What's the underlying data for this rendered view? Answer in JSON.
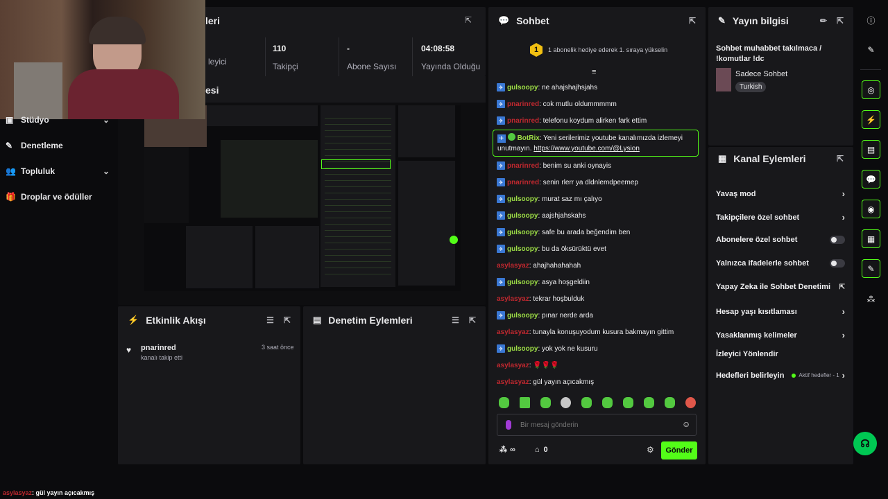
{
  "top_panel": {
    "title_fragment": "leri"
  },
  "stats": [
    {
      "value": "",
      "label": "leyici"
    },
    {
      "value": "110",
      "label": "Takipçi"
    },
    {
      "value": "-",
      "label": "Abone Sayısı"
    },
    {
      "value": "04:08:58",
      "label": "Yayında Olduğu"
    }
  ],
  "preview_title_fragment": "esi",
  "sidebar": {
    "items": [
      {
        "label": "Stüdyo",
        "icon": "video-icon",
        "has_chevron": true
      },
      {
        "label": "Denetleme",
        "icon": "wrench-icon",
        "has_chevron": false
      },
      {
        "label": "Topluluk",
        "icon": "people-icon",
        "has_chevron": true
      },
      {
        "label": "Droplar ve ödüller",
        "icon": "gift-icon",
        "has_chevron": false
      }
    ]
  },
  "activity": {
    "title": "Etkinlik Akışı",
    "event": {
      "user": "pnarinred",
      "action": "kanalı takip etti",
      "time": "3 saat önce"
    }
  },
  "moderation": {
    "title": "Denetim Eylemleri"
  },
  "chat": {
    "title": "Sohbet",
    "pinned": {
      "rank": "1",
      "text": "1 abonelik hediye ederek 1. sıraya yükselin"
    },
    "messages": [
      {
        "user": "gulsoopy",
        "color": "green",
        "badge": true,
        "text": ": ne ahajshajhsjahs"
      },
      {
        "user": "pnarinred",
        "color": "red",
        "badge": true,
        "text": ": cok mutlu oldummmmm"
      },
      {
        "user": "pnarinred",
        "color": "red",
        "badge": true,
        "text": ": telefonu koydum alirken fark ettim"
      },
      {
        "user": "pnarinred",
        "color": "red",
        "badge": true,
        "text": ": benim su anki oynayis"
      },
      {
        "user": "pnarinred",
        "color": "red",
        "badge": true,
        "text": ": senin rlerr ya dldnlemdpeemep"
      },
      {
        "user": "gulsoopy",
        "color": "green",
        "badge": true,
        "text": ": murat saz mı çalıyo"
      },
      {
        "user": "gulsoopy",
        "color": "green",
        "badge": true,
        "text": ": aajshjahskahs"
      },
      {
        "user": "gulsoopy",
        "color": "green",
        "badge": true,
        "text": ": safe bu arada beğendim ben"
      },
      {
        "user": "gulsoopy",
        "color": "green",
        "badge": true,
        "text": ": bu da öksürüktü evet"
      },
      {
        "user": "asylasyaz",
        "color": "red",
        "badge": false,
        "text": ": ahajhahahahah"
      },
      {
        "user": "gulsoopy",
        "color": "green",
        "badge": true,
        "text": ": asya hoşgeldiin"
      },
      {
        "user": "asylasyaz",
        "color": "red",
        "badge": false,
        "text": ": tekrar hoşbulduk"
      },
      {
        "user": "gulsoopy",
        "color": "green",
        "badge": true,
        "text": ": pınar nerde arda"
      },
      {
        "user": "asylasyaz",
        "color": "red",
        "badge": false,
        "text": ": tunayla konuşuyodum kusura bakmayın gittim"
      },
      {
        "user": "gulsoopy",
        "color": "green",
        "badge": true,
        "text": ": yok yok ne kusuru"
      },
      {
        "user": "asylasyaz",
        "color": "red",
        "badge": false,
        "text": ": 🌹🌹🌹"
      },
      {
        "user": "asylasyaz",
        "color": "red",
        "badge": false,
        "text": ": gül yayın açıcakmış"
      }
    ],
    "bot": {
      "user": "BotRix",
      "text": ": Yeni serilerimiz youtube kanalımızda izlemeyi unutmayın.",
      "link": "https://www.youtube.com/@Lysion"
    },
    "input_placeholder": "Bir mesaj gönderin",
    "footer": {
      "infinity": "∞",
      "count": "0",
      "send_label": "Gönder"
    }
  },
  "stream_info": {
    "title": "Yayın bilgisi",
    "stream_title": "Sohbet muhabbet takılmaca / !komutlar !dc",
    "category": "Sadece Sohbet",
    "tag": "Turkish"
  },
  "channel_actions": {
    "title": "Kanal Eylemleri",
    "items": [
      {
        "label": "Yavaş mod",
        "control": "chevron"
      },
      {
        "label": "Takipçilere özel sohbet",
        "control": "chevron"
      },
      {
        "label": "Abonelere özel sohbet",
        "control": "toggle"
      },
      {
        "label": "Yalnızca ifadelerle sohbet",
        "control": "toggle"
      },
      {
        "label": "Yapay Zeka ile Sohbet Denetimi",
        "control": "external"
      },
      {
        "label": "Hesap yaşı kısıtlaması",
        "control": "chevron"
      },
      {
        "label": "Yasaklanmış kelimeler",
        "control": "chevron"
      },
      {
        "label": "İzleyici Yönlendir",
        "control": "none"
      },
      {
        "label": "Hedefleri belirleyin",
        "control": "chevron",
        "extra": "Aktif hedefler - 1"
      }
    ]
  },
  "overlay_chat": {
    "user": "asylasyaz",
    "text": ": gül yayın açıcakmış"
  },
  "colors": {
    "accent": "#53fc18",
    "panel": "#18181b",
    "bg": "#0b0b0d",
    "username_green": "#9dde46",
    "username_red": "#c0282f"
  }
}
